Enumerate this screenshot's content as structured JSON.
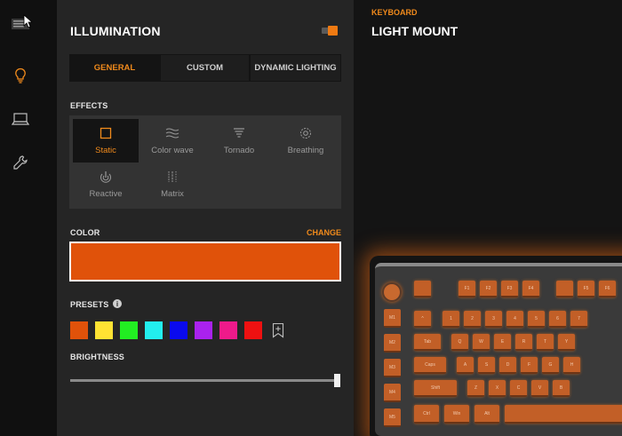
{
  "panel": {
    "title": "ILLUMINATION",
    "toggle_on": true,
    "tabs": [
      "GENERAL",
      "CUSTOM",
      "DYNAMIC LIGHTING"
    ],
    "active_tab": "GENERAL"
  },
  "effects": {
    "label": "EFFECTS",
    "items": [
      {
        "label": "Static",
        "icon": "square-icon",
        "selected": true
      },
      {
        "label": "Color wave",
        "icon": "wave-icon",
        "selected": false
      },
      {
        "label": "Tornado",
        "icon": "tornado-icon",
        "selected": false
      },
      {
        "label": "Breathing",
        "icon": "breathing-icon",
        "selected": false
      },
      {
        "label": "Reactive",
        "icon": "reactive-icon",
        "selected": false
      },
      {
        "label": "Matrix",
        "icon": "matrix-icon",
        "selected": false
      }
    ]
  },
  "color": {
    "label": "COLOR",
    "change_label": "CHANGE",
    "current": "#e0520a"
  },
  "presets": {
    "label": "PRESETS",
    "info_icon": "i",
    "colors": [
      "#e0520a",
      "#ffe333",
      "#22ee22",
      "#22eeee",
      "#0a0aee",
      "#aa22ee",
      "#ee1a8a",
      "#ee1111"
    ]
  },
  "brightness": {
    "label": "BRIGHTNESS",
    "value": 1.0
  },
  "device": {
    "category": "KEYBOARD",
    "name": "LIGHT MOUNT"
  },
  "keyboard": {
    "fn_row": [
      "",
      "F1",
      "F2",
      "F3",
      "F4",
      "",
      "F5",
      "F6"
    ],
    "row1": [
      "^",
      "1",
      "2",
      "3",
      "4",
      "5",
      "6",
      "7"
    ],
    "row2": [
      "Tab",
      "Q",
      "W",
      "E",
      "R",
      "T",
      "Y"
    ],
    "row3": [
      "Caps",
      "A",
      "S",
      "D",
      "F",
      "G",
      "H"
    ],
    "row4": [
      "Shift",
      "Z",
      "X",
      "C",
      "V",
      "B"
    ],
    "row5": [
      "Ctrl",
      "Win",
      "Alt"
    ],
    "macro_keys": [
      "M1",
      "M2",
      "M3",
      "M4",
      "M5"
    ]
  },
  "colors": {
    "accent": "#f08a1c",
    "panel_bg": "#252525",
    "rail_bg": "#101010",
    "key_orange": "#c25f27"
  }
}
